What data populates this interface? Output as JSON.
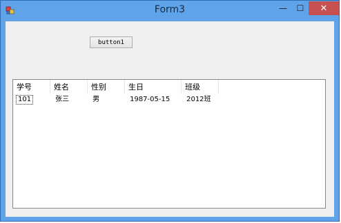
{
  "window": {
    "title": "Form3",
    "controls": {
      "minimize": "—",
      "maximize": "☐",
      "close": "✕"
    }
  },
  "form": {
    "button1_label": "button1"
  },
  "listview": {
    "columns": [
      "学号",
      "姓名",
      "性别",
      "生日",
      "班级"
    ],
    "rows": [
      [
        "101",
        "张三",
        "男",
        "1987-05-15",
        "2012班"
      ]
    ]
  },
  "colors": {
    "titlebar": "#5fa3e8",
    "close_button": "#c75050",
    "client_bg": "#f0f0f0"
  }
}
